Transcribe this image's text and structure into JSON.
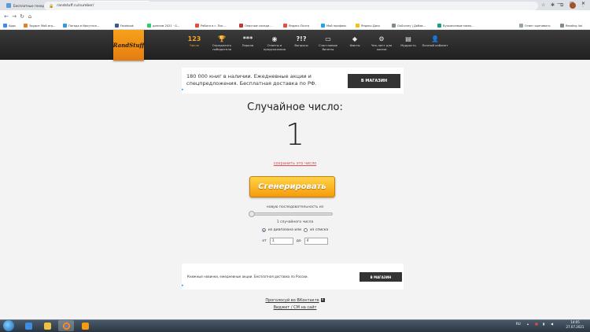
{
  "browser": {
    "tabs": [
      {
        "title": "Бесплатные генераторы 17 - Пои",
        "active": false,
        "color": "#5b9bd5"
      },
      {
        "title": "RandStuff.ru - Генератор случайн",
        "active": true,
        "color": "#f5a623"
      }
    ],
    "url": "randstuff.ru/number/",
    "bookmarks": [
      {
        "label": "Apps",
        "color": "#4285f4"
      },
      {
        "label": "Эрудит Мой игр...",
        "color": "#e67e22"
      },
      {
        "label": "Погода в Иркутске...",
        "color": "#3498db"
      },
      {
        "label": "Facebook",
        "color": "#3b5998"
      },
      {
        "label": "диплом 2021 · G...",
        "color": "#2ecc71"
      },
      {
        "label": "Работа в г. Пос...",
        "color": "#e74c3c"
      },
      {
        "label": "Опасные соседи ...",
        "color": "#c0392b"
      },
      {
        "label": "Яндекс.Почта",
        "color": "#e74c3c"
      },
      {
        "label": "Мой профиль",
        "color": "#1da1f2"
      },
      {
        "label": "Яндекс.Диск",
        "color": "#f1c40f"
      },
      {
        "label": "GoSurvey | Добав...",
        "color": "#7f8c8d"
      },
      {
        "label": "Вуокансевые мюнк...",
        "color": "#16a085"
      },
      {
        "label": "Ответ оценивать",
        "color": "#95a5a6"
      },
      {
        "label": "Reading list",
        "color": "#7f8c8d"
      }
    ]
  },
  "site": {
    "logo": "RandStuff",
    "nav": [
      {
        "icon": "123",
        "label": "Число",
        "active": true
      },
      {
        "icon": "🏆",
        "label": "Определить победителя",
        "active": false
      },
      {
        "icon": "***",
        "label": "Пароли",
        "active": false
      },
      {
        "icon": "◉",
        "label": "Ответы и предсказания",
        "active": false
      },
      {
        "icon": "?!?",
        "label": "Вопросы",
        "active": false
      },
      {
        "icon": "▭",
        "label": "Счастливые билеты",
        "active": false
      },
      {
        "icon": "◆",
        "label": "Факты",
        "active": false
      },
      {
        "icon": "⚙",
        "label": "Чек-лист для жизни",
        "active": false
      },
      {
        "icon": "▤",
        "label": "Мудрость",
        "active": false
      },
      {
        "icon": "👤",
        "label": "Личный кабинет",
        "active": false
      }
    ]
  },
  "ad_top": {
    "text": "180 000 книг в наличии. Ежедневные акции и спецпредложения. Бесплатная доставка по РФ.",
    "button": "В МАГАЗИН"
  },
  "main": {
    "title": "Случайное число:",
    "number": "1",
    "save_link": "сохранить это число",
    "generate_button": "Сгенерировать",
    "sequence_label": "новую последовательность из",
    "slider_value": 0,
    "count_label": "1 случайного числа",
    "radio_range": "из диапазона или",
    "radio_list": "из списка",
    "from_label": "от",
    "from_value": "1",
    "to_label": "до",
    "to_value": "4"
  },
  "ad_bottom": {
    "text": "Книжные новинки, ежедневные акции. Бесплатная доставка по России.",
    "button": "В МАГАЗИН"
  },
  "footer": {
    "vk_link": "Проголосуй во ВКонтакте",
    "vk_icon": "В",
    "widget_link": "Виджет / CM на сайт"
  },
  "taskbar": {
    "lang": "RU",
    "time": "14:05",
    "date": "27.07.2021"
  }
}
